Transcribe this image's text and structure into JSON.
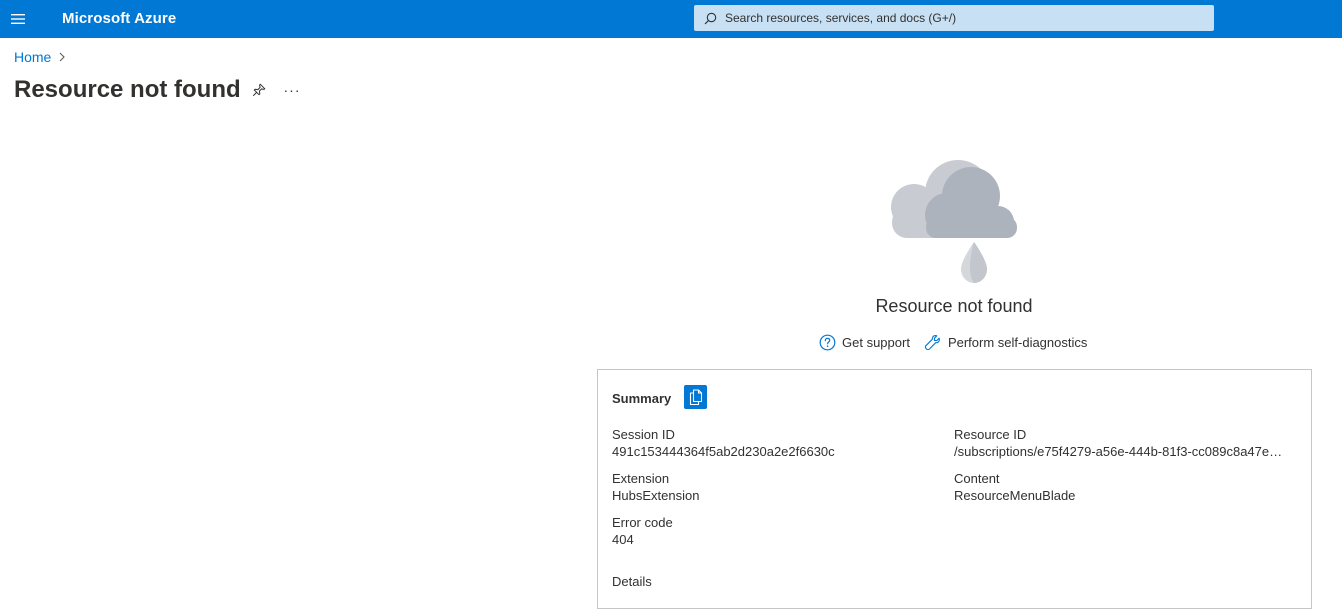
{
  "header": {
    "menu_icon": "hamburger-icon",
    "brand": "Microsoft Azure",
    "search_placeholder": "Search resources, services, and docs (G+/)",
    "search_icon": "search-icon",
    "color": "#0078d4"
  },
  "breadcrumb": {
    "items": [
      {
        "label": "Home"
      }
    ],
    "separator_icon": "chevron-right-icon"
  },
  "page": {
    "title": "Resource not found",
    "pin_icon": "pin-icon",
    "more_label": "···"
  },
  "error": {
    "illustration": "cloud-raindrop-icon",
    "heading": "Resource not found",
    "links": [
      {
        "label": "Get support",
        "icon": "question-circle-icon"
      },
      {
        "label": "Perform self-diagnostics",
        "icon": "wrench-icon"
      }
    ]
  },
  "summary": {
    "title": "Summary",
    "copy_icon": "copy-icon",
    "session_id_label": "Session ID",
    "session_id_value": "491c153444364f5ab2d230a2e2f6630c",
    "resource_id_label": "Resource ID",
    "resource_id_value": "/subscriptions/e75f4279-a56e-444b-81f3-cc089c8a47e0...",
    "extension_label": "Extension",
    "extension_value": "HubsExtension",
    "content_label": "Content",
    "content_value": "ResourceMenuBlade",
    "error_code_label": "Error code",
    "error_code_value": "404",
    "details_label": "Details"
  }
}
